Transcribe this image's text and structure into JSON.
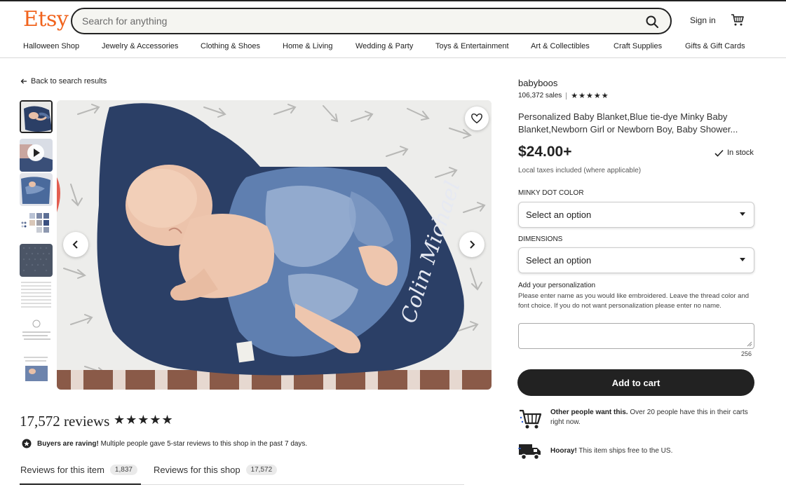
{
  "header": {
    "logo": "Etsy",
    "search_placeholder": "Search for anything",
    "signin": "Sign in"
  },
  "nav": [
    "Halloween Shop",
    "Jewelry & Accessories",
    "Clothing & Shoes",
    "Home & Living",
    "Wedding & Party",
    "Toys & Entertainment",
    "Art & Collectibles",
    "Craft Supplies",
    "Gifts & Gift Cards"
  ],
  "back_link": "Back to search results",
  "image_text": "Colin Michael",
  "reviews": {
    "title": "17,572 reviews",
    "stars": "★★★★★",
    "raving_bold": "Buyers are raving!",
    "raving_text": "Multiple people gave 5-star reviews to this shop in the past 7 days.",
    "tab_item_label": "Reviews for this item",
    "tab_item_count": "1,837",
    "tab_shop_label": "Reviews for this shop",
    "tab_shop_count": "17,572"
  },
  "listing": {
    "shop_name": "babyboos",
    "sales": "106,372 sales",
    "rating_stars": "★★★★★",
    "title": "Personalized Baby Blanket,Blue tie-dye Minky Baby Blanket,Newborn Girl or Newborn Boy, Baby Shower...",
    "price": "$24.00+",
    "stock": "In stock",
    "tax_note": "Local taxes included (where applicable)",
    "option1_label": "MINKY DOT COLOR",
    "option1_value": "Select an option",
    "option2_label": "DIMENSIONS",
    "option2_value": "Select an option",
    "personalization_label": "Add your personalization",
    "personalization_help": "Please enter name as you would like embroidered. Leave the thread color and font choice. If you do not want personalization please enter no name.",
    "personalization_count": "256",
    "add_to_cart": "Add to cart",
    "info1_bold": "Other people want this.",
    "info1_text": "Over 20 people have this in their carts right now.",
    "info2_bold": "Hooray!",
    "info2_text": "This item ships free to the US."
  },
  "colors": {
    "brand": "#f1641e",
    "button": "#222222",
    "blanket": "#2b3f66"
  }
}
